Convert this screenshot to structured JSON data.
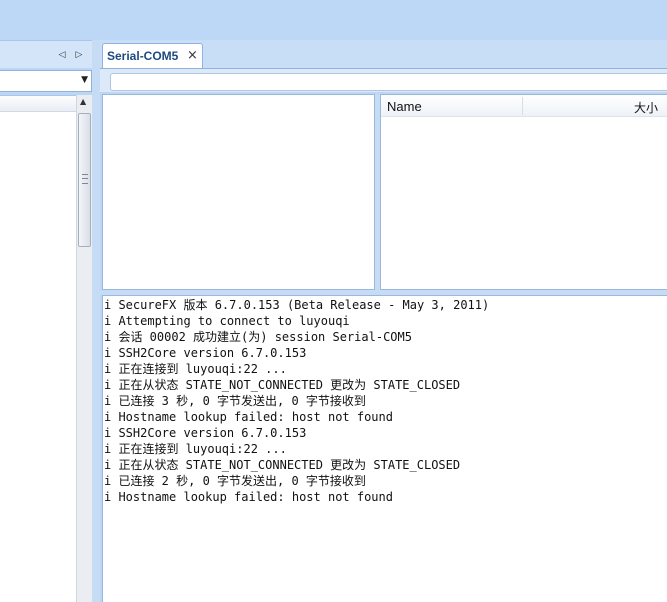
{
  "session_tab": {
    "label": "Serial-COM5",
    "close_glyph": "×"
  },
  "left_panel": {
    "prev_glyph": "◁",
    "next_glyph": "▷",
    "combo_value": ""
  },
  "file_list": {
    "columns": [
      "Name",
      "大小"
    ]
  },
  "log": {
    "lines": [
      "i SecureFX 版本 6.7.0.153 (Beta Release - May 3, 2011)",
      "i Attempting to connect to luyouqi",
      "i 会话 00002 成功建立(为) session Serial-COM5",
      "i SSH2Core version 6.7.0.153",
      "i 正在连接到 luyouqi:22 ...",
      "i 正在从状态 STATE_NOT_CONNECTED 更改为 STATE_CLOSED",
      "i 已连接 3 秒, 0 字节发送出, 0 字节接收到",
      "i Hostname lookup failed: host not found",
      "i SSH2Core version 6.7.0.153",
      "i 正在连接到 luyouqi:22 ...",
      "i 正在从状态 STATE_NOT_CONNECTED 更改为 STATE_CLOSED",
      "i 已连接 2 秒, 0 字节发送出, 0 字节接收到",
      "i Hostname lookup failed: host not found"
    ]
  }
}
